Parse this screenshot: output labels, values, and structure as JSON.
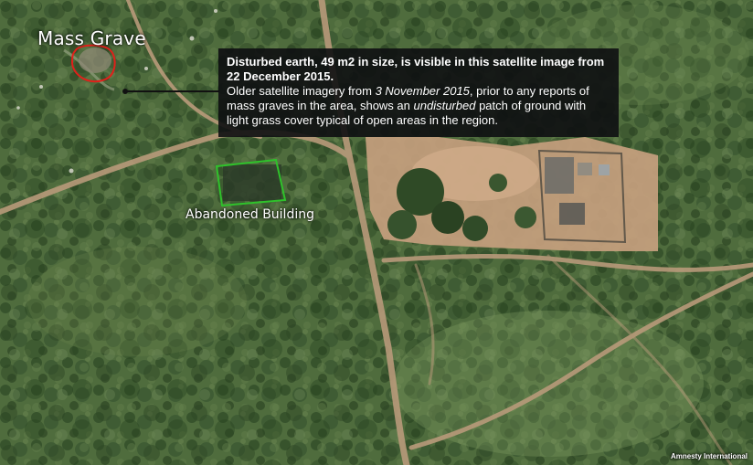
{
  "map": {
    "labels": {
      "mass_grave": "Mass Grave",
      "abandoned_building": "Abandoned Building"
    },
    "callout": {
      "headline": "Disturbed earth, 49 m2 in size, is visible in this satellite image from 22 December 2015.",
      "body_1": "Older satellite imagery from ",
      "body_date": "3 November 2015",
      "body_2": ", prior to any reports of mass graves in the area, shows an ",
      "body_em": "undisturbed",
      "body_3": " patch of ground with light grass cover typical of open areas in the region."
    },
    "credit": "Amnesty International",
    "colors": {
      "grave_outline": "#e0201a",
      "building_outline": "#2fc22b",
      "callout_bg": "#0e1012",
      "vegetation": "#4d6b3c",
      "bare_ground": "#c6a07e"
    }
  }
}
